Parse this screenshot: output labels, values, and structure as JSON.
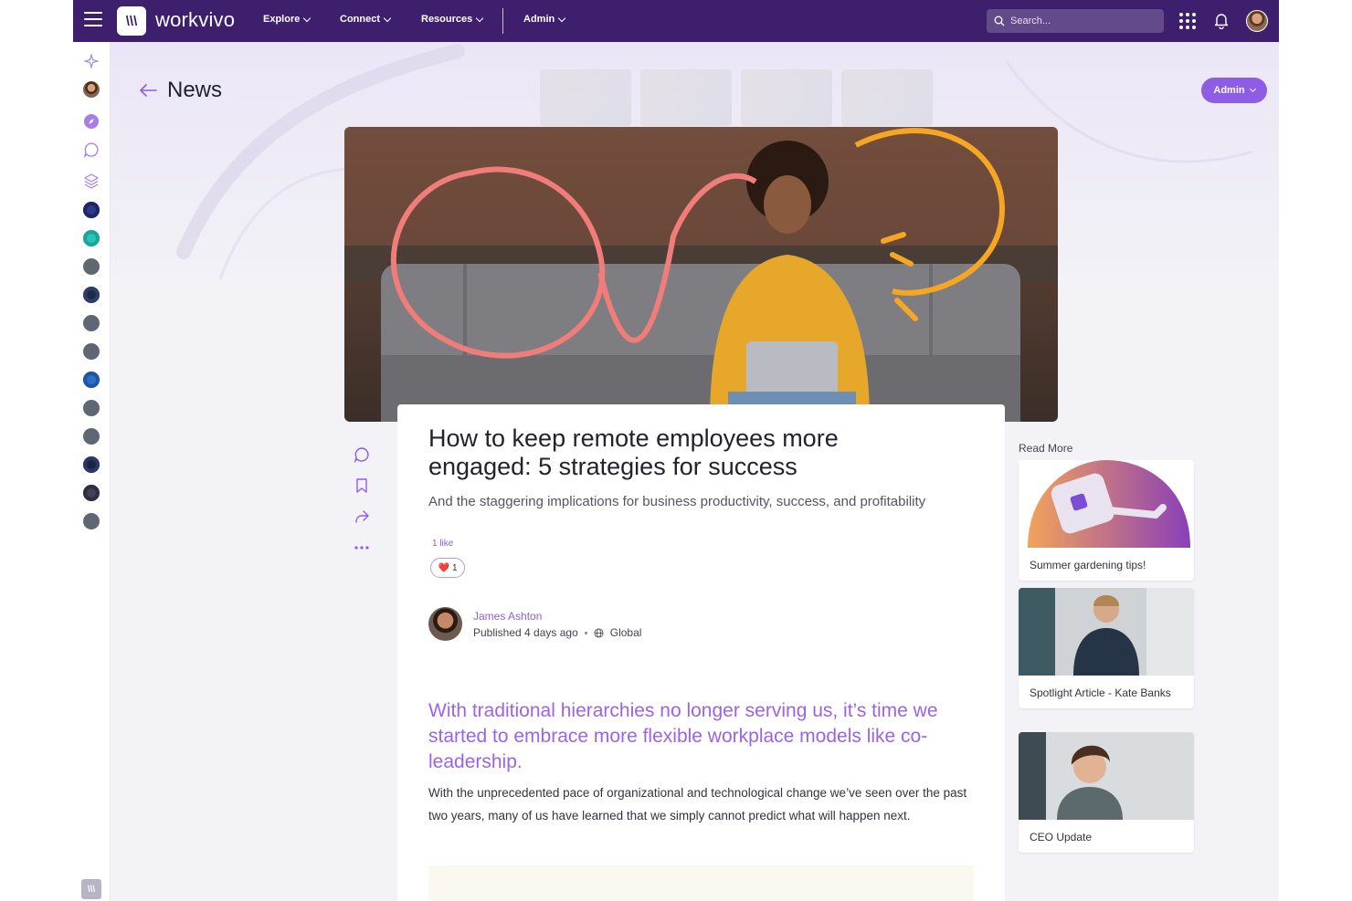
{
  "brand": {
    "name": "workvivo",
    "logo_glyph": "\\\\\\",
    "accent": "#8f5ce6",
    "nav_bg": "#3d1f6e"
  },
  "nav": {
    "items": [
      {
        "label": "Explore"
      },
      {
        "label": "Connect"
      },
      {
        "label": "Resources"
      },
      {
        "label": "Admin"
      }
    ],
    "search_placeholder": "Search..."
  },
  "page": {
    "title": "News",
    "admin_button": "Admin"
  },
  "article": {
    "title": "How to keep remote employees more engaged: 5 strategies for success",
    "subtitle": "And the staggering implications for business productivity, success, and profitability",
    "likes_text": "1 like",
    "reaction": {
      "emoji": "❤️",
      "count": "1"
    },
    "author": "James Ashton",
    "published": "Published 4 days ago",
    "audience": "Global",
    "lead": "With traditional hierarchies no longer serving us, it’s time we started to embrace more flexible workplace models like co-leadership.",
    "body": "With the unprecedented pace of organizational and technological change we’ve seen over the past two years, many of us have learned that we simply cannot predict what will happen next."
  },
  "actions": [
    "comment-icon",
    "bookmark-icon",
    "share-icon",
    "more-icon"
  ],
  "read_more": {
    "title": "Read More",
    "items": [
      {
        "label": "Summer gardening tips!"
      },
      {
        "label": "Spotlight Article - Kate Banks"
      },
      {
        "label": "CEO Update"
      }
    ]
  }
}
